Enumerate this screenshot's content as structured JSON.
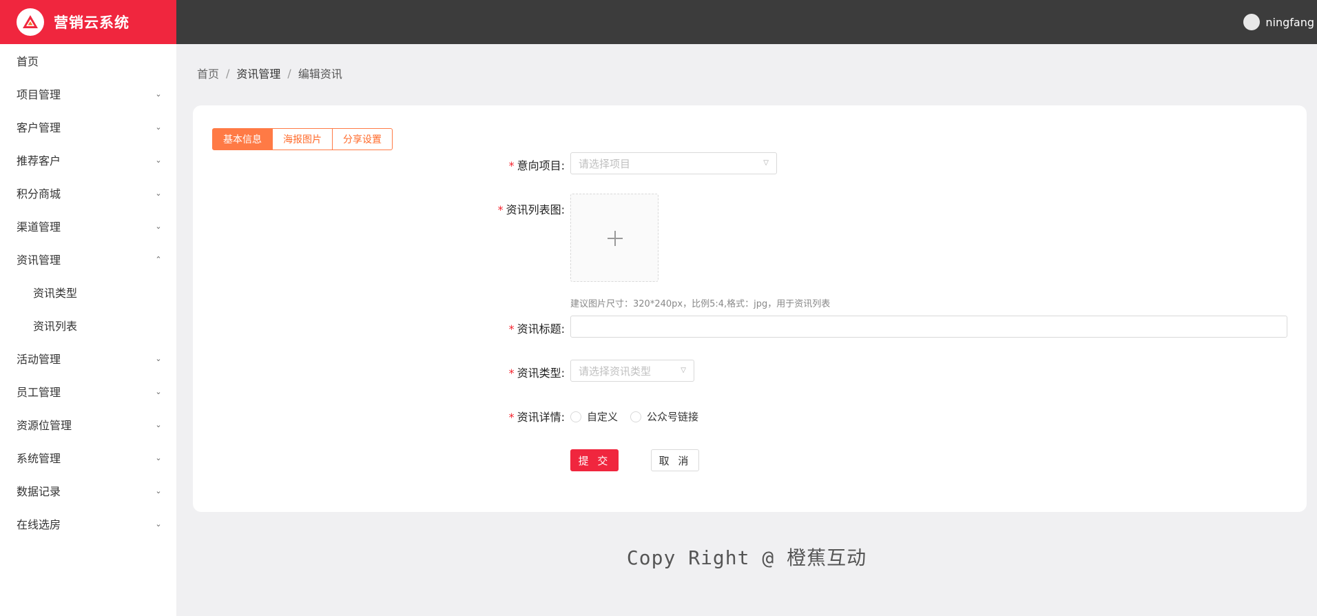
{
  "app": {
    "title": "营销云系统"
  },
  "user": {
    "name": "ningfang"
  },
  "sidebar": {
    "items": [
      {
        "label": "首页"
      },
      {
        "label": "项目管理"
      },
      {
        "label": "客户管理"
      },
      {
        "label": "推荐客户"
      },
      {
        "label": "积分商城"
      },
      {
        "label": "渠道管理"
      },
      {
        "label": "资讯管理"
      },
      {
        "label": "资讯类型"
      },
      {
        "label": "资讯列表"
      },
      {
        "label": "活动管理"
      },
      {
        "label": "员工管理"
      },
      {
        "label": "资源位管理"
      },
      {
        "label": "系统管理"
      },
      {
        "label": "数据记录"
      },
      {
        "label": "在线选房"
      }
    ]
  },
  "breadcrumb": {
    "home": "首页",
    "section": "资讯管理",
    "current": "编辑资讯",
    "separator": "/"
  },
  "tabs": [
    {
      "label": "基本信息",
      "active": true
    },
    {
      "label": "海报图片",
      "active": false
    },
    {
      "label": "分享设置",
      "active": false
    }
  ],
  "form": {
    "required_mark": "*",
    "project": {
      "label": "意向项目:",
      "placeholder": "请选择项目"
    },
    "list_image": {
      "label": "资讯列表图:",
      "hint": "建议图片尺寸：320*240px，比例5:4,格式：jpg，用于资讯列表"
    },
    "title": {
      "label": "资讯标题:",
      "value": ""
    },
    "type": {
      "label": "资讯类型:",
      "placeholder": "请选择资讯类型"
    },
    "detail": {
      "label": "资讯详情:",
      "options": [
        "自定义",
        "公众号链接"
      ]
    },
    "submit_label": "提 交",
    "cancel_label": "取 消"
  },
  "footer": {
    "text": "Copy Right @ 橙蕉互动"
  },
  "colors": {
    "brand": "#f0263e",
    "accent": "#ff7a45",
    "topbar": "#3c3c3c"
  }
}
